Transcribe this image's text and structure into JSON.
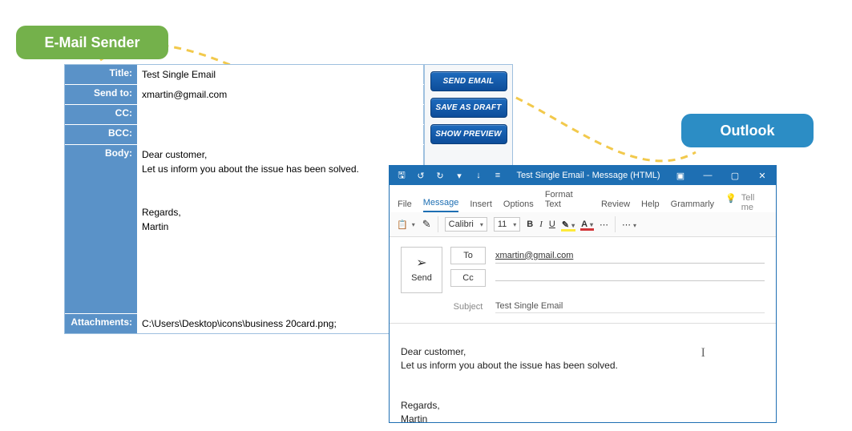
{
  "pills": {
    "sender_label": "E-Mail Sender",
    "outlook_label": "Outlook"
  },
  "sender": {
    "labels": {
      "title": "Title:",
      "send_to": "Send to:",
      "cc": "CC:",
      "bcc": "BCC:",
      "body": "Body:",
      "attachments": "Attachments:"
    },
    "values": {
      "title": "Test Single Email",
      "send_to": "xmartin@gmail.com",
      "cc": "",
      "bcc": "",
      "body": "Dear customer,\nLet us inform you about the issue has been solved.\n\n\nRegards,\nMartin",
      "attachments": "C:\\Users\\Desktop\\icons\\business 20card.png;"
    },
    "buttons": {
      "send_email": "SEND EMAIL",
      "save_draft": "SAVE AS DRAFT",
      "show_preview": "SHOW PREVIEW"
    }
  },
  "outlook": {
    "titlebar": {
      "title": "Test Single Email  -  Message (HTML)"
    },
    "tabs": {
      "file": "File",
      "message": "Message",
      "insert": "Insert",
      "options": "Options",
      "format_text": "Format Text",
      "review": "Review",
      "help": "Help",
      "grammarly": "Grammarly",
      "tell_me": "Tell me"
    },
    "ribbon": {
      "font_name": "Calibri",
      "font_size": "11"
    },
    "compose": {
      "send": "Send",
      "to_label": "To",
      "cc_label": "Cc",
      "to_value": "xmartin@gmail.com",
      "subject_label": "Subject",
      "subject_value": "Test Single Email",
      "body": "Dear customer,\nLet us inform you about the issue has been solved.\n\n\nRegards,\nMartin"
    }
  }
}
